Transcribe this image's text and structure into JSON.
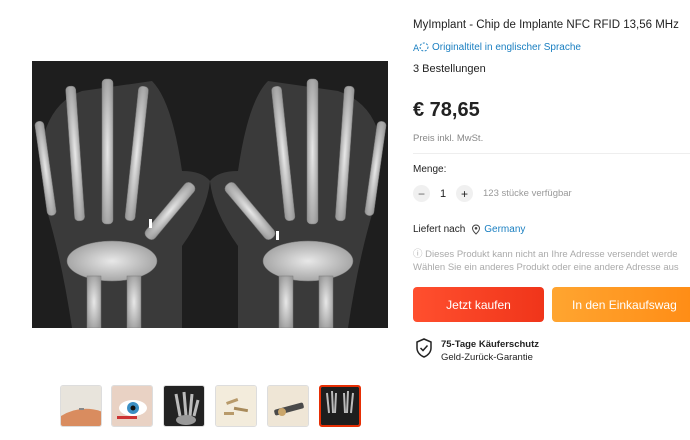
{
  "product": {
    "title": "MyImplant - Chip de Implante NFC RFID 13,56 MHz",
    "translate_link": "Originaltitel in englischer Sprache",
    "orders": "3 Bestellungen",
    "price": "€ 78,65",
    "vat_note": "Preis inkl. MwSt."
  },
  "quantity": {
    "label": "Menge:",
    "value": "1",
    "minus": "−",
    "plus": "+",
    "stock": "123 stücke verfügbar"
  },
  "shipping": {
    "label": "Liefert nach",
    "country": "Germany",
    "warning_line1": "ⓘ Dieses Produkt kann nicht an Ihre Adresse versendet werde",
    "warning_line2": "Wählen Sie ein anderes Produkt oder eine andere Adresse aus"
  },
  "buttons": {
    "buy_now": "Jetzt kaufen",
    "add_to_cart": "In den Einkaufswag"
  },
  "protection": {
    "title": "75-Tage Käuferschutz",
    "subtitle": "Geld-Zurück-Garantie"
  },
  "gallery": {
    "thumbnails": [
      {
        "subject": "finger-implant"
      },
      {
        "subject": "eye-closeup"
      },
      {
        "subject": "hand-xray-single"
      },
      {
        "subject": "implant-chips"
      },
      {
        "subject": "chip-injector"
      },
      {
        "subject": "hands-xray",
        "active": true
      }
    ]
  },
  "colors": {
    "accent_red": "#e62e04",
    "buy_button": "#f5381a",
    "cart_button": "#ff9a22",
    "link_blue": "#1a7fc1"
  }
}
